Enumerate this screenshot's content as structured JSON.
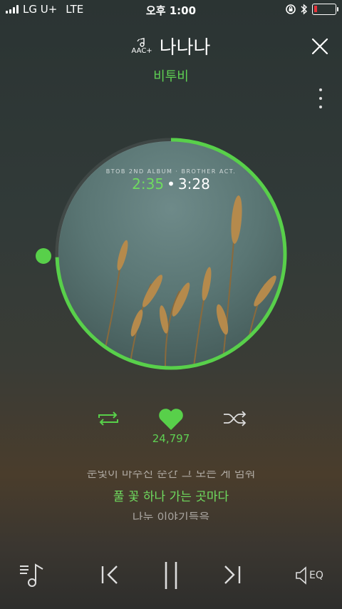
{
  "status_bar": {
    "carrier": "LG U+",
    "network": "LTE",
    "time": "오후 1:00",
    "battery_color": "#e8333a"
  },
  "header": {
    "codec_label": "AAC+",
    "song_title": "나나나",
    "artist": "비투비",
    "close_icon": "close-icon",
    "more_icon": "more-vertical-icon"
  },
  "player": {
    "album_label": "BTOB 2ND ALBUM · BROTHER ACT.",
    "current_time": "2:35",
    "separator": "•",
    "total_time": "3:28",
    "progress_fraction": 0.745,
    "accent_color": "#58d04a"
  },
  "actions": {
    "repeat_icon": "repeat-icon",
    "like_icon": "heart-icon",
    "like_count": "24,797",
    "shuffle_icon": "shuffle-icon"
  },
  "lyrics": {
    "previous_line": "눈빛이 마주친 순간 그 모든 게 멈춰",
    "current_line": "풀 꽃 하나 가는 곳마다",
    "next_line": "나눈 이야기들을"
  },
  "bottom_controls": {
    "playlist_icon": "playlist-icon",
    "prev_icon": "previous-icon",
    "pause_icon": "pause-icon",
    "next_icon": "next-icon",
    "eq_label": "EQ"
  }
}
